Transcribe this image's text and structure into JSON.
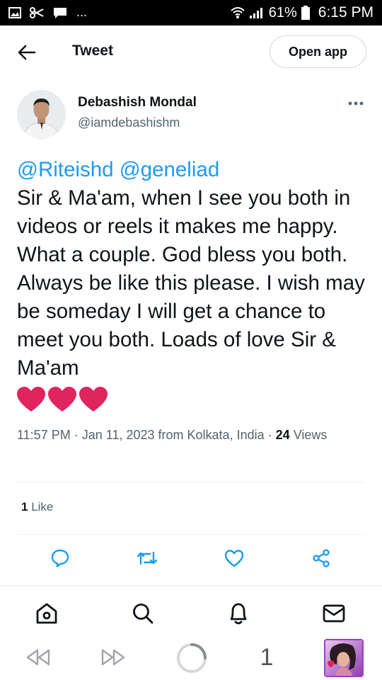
{
  "status_bar": {
    "battery_percent": "61%",
    "time": "6:15 PM",
    "overflow": "..."
  },
  "header": {
    "title": "Tweet",
    "open_app_label": "Open app"
  },
  "author": {
    "name": "Debashish Mondal",
    "handle": "@iamdebashishm"
  },
  "tweet": {
    "mention_1": "@Riteishd",
    "mention_2": "@geneliad",
    "body": "Sir & Ma'am, when I see you both in videos or reels it makes me happy. What a couple. God bless you both. Always be like this please. I wish may be someday I will get a chance to meet you both. Loads of love Sir & Ma'am",
    "emoji": "❤️❤️❤️"
  },
  "meta": {
    "time": "11:57 PM",
    "sep": "·",
    "date": "Jan 11, 2023",
    "from_location": "from Kolkata, India",
    "views_count": "24",
    "views_label": "Views"
  },
  "likes": {
    "count": "1",
    "label": "Like"
  },
  "browser": {
    "tab_count": "1"
  },
  "colors": {
    "accent": "#1d9bf0",
    "text": "#0f1419",
    "muted": "#536471",
    "heart": "#e0245e"
  }
}
